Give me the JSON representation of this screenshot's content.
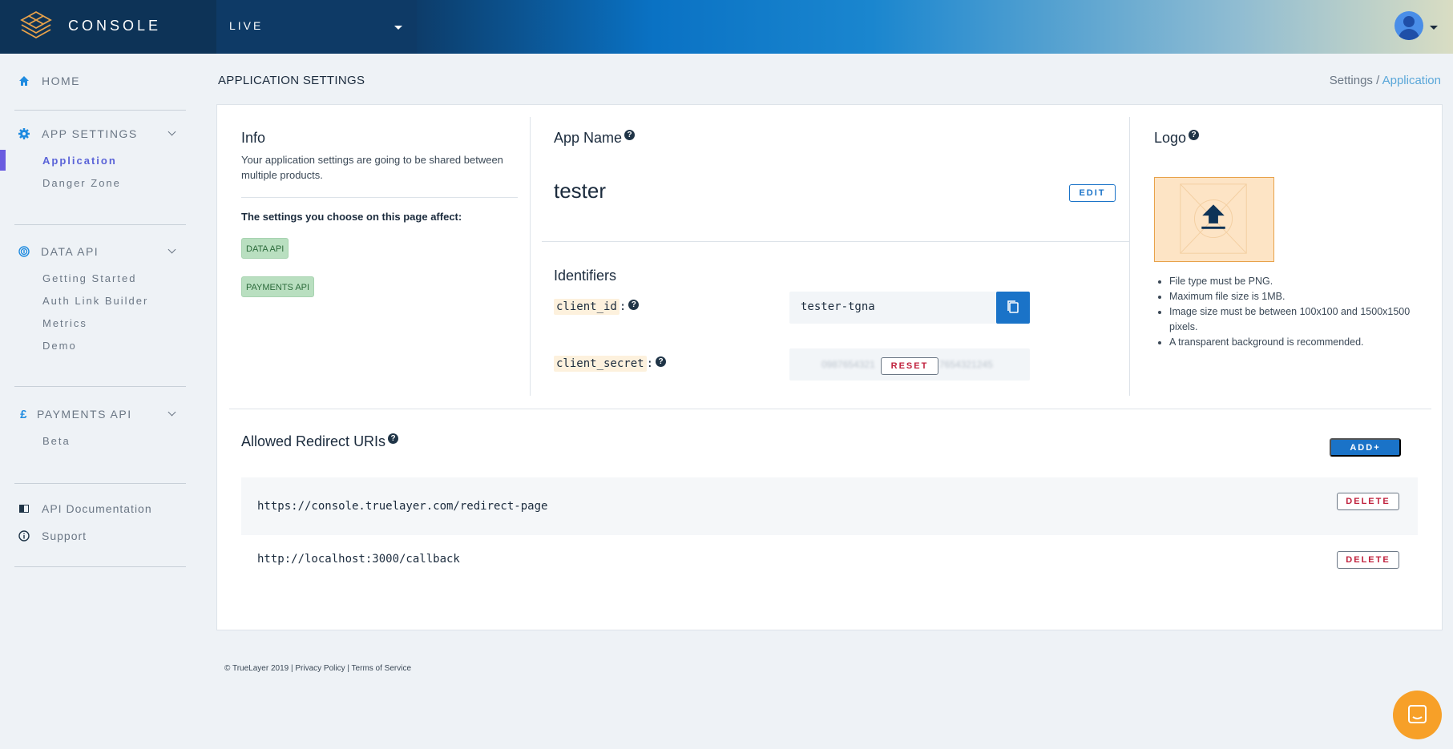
{
  "app": {
    "brand": "CONSOLE",
    "environment": "LIVE"
  },
  "sidebar": {
    "home": "HOME",
    "app_settings": {
      "label": "APP SETTINGS",
      "items": [
        "Application",
        "Danger Zone"
      ]
    },
    "data_api": {
      "label": "DATA API",
      "items": [
        "Getting Started",
        "Auth Link Builder",
        "Metrics",
        "Demo"
      ]
    },
    "payments_api": {
      "label": "PAYMENTS API",
      "items": [
        "Beta"
      ]
    },
    "links": [
      "API Documentation",
      "Support"
    ]
  },
  "page": {
    "title": "APPLICATION SETTINGS",
    "breadcrumb": {
      "parent": "Settings",
      "separator": "/",
      "current": "Application"
    }
  },
  "info": {
    "title": "Info",
    "description": "Your application settings are going to be shared between multiple products.",
    "affects_label": "The settings you choose on this page affect:",
    "tags": [
      "DATA API",
      "PAYMENTS API"
    ]
  },
  "app_name": {
    "title": "App Name",
    "value": "tester",
    "edit_label": "EDIT"
  },
  "identifiers": {
    "title": "Identifiers",
    "client_id": {
      "label": "client_id",
      "value": "tester-tgna"
    },
    "client_secret": {
      "label": "client_secret",
      "masked_left": "0987654321",
      "masked_right": "7654321245",
      "reset_label": "RESET"
    }
  },
  "logo": {
    "title": "Logo",
    "rules": [
      "File type must be PNG.",
      "Maximum file size is 1MB.",
      "Image size must be between 100x100 and 1500x1500 pixels.",
      "A transparent background is recommended."
    ]
  },
  "redirects": {
    "title": "Allowed Redirect URIs",
    "add_label": "ADD+",
    "delete_label": "DELETE",
    "uris": [
      "https://console.truelayer.com/redirect-page",
      "http://localhost:3000/callback"
    ]
  },
  "footer": {
    "text": "© TrueLayer 2019 | Privacy Policy | Terms of Service"
  },
  "colors": {
    "accent": "#1a73c8",
    "active_nav": "#5a63d8",
    "danger": "#c0223e",
    "tag_bg": "#b9dfc0",
    "logo_bg": "#fde4c5",
    "chat": "#f7a028"
  }
}
